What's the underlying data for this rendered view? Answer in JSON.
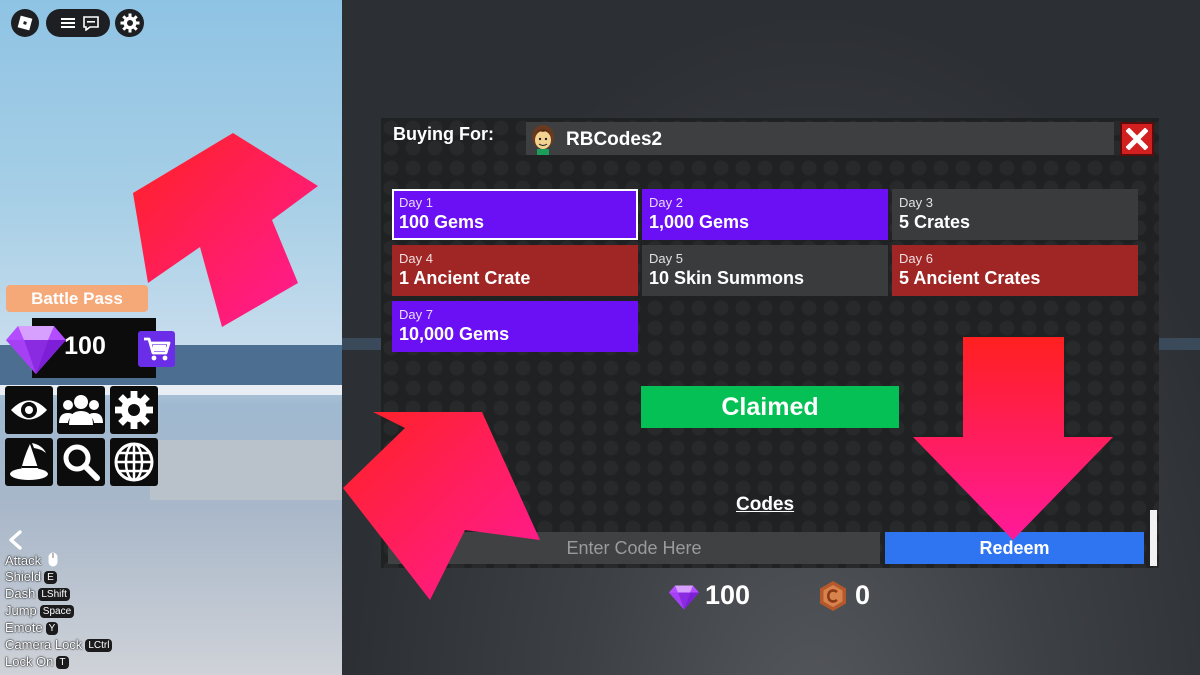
{
  "hud": {
    "battle_pass_label": "Battle Pass",
    "gem_count": "100"
  },
  "controls": [
    {
      "action": "Attack",
      "key": ""
    },
    {
      "action": "Shield",
      "key": "E"
    },
    {
      "action": "Dash",
      "key": "LShift"
    },
    {
      "action": "Jump",
      "key": "Space"
    },
    {
      "action": "Emote",
      "key": "Y"
    },
    {
      "action": "Camera Lock",
      "key": "LCtrl"
    },
    {
      "action": "Lock On",
      "key": "T"
    }
  ],
  "dialog": {
    "buying_for_label": "Buying For:",
    "username": "RBCodes2",
    "days": [
      {
        "label": "Day 1",
        "reward": "100 Gems",
        "style": "purple",
        "selected": true
      },
      {
        "label": "Day 2",
        "reward": "1,000 Gems",
        "style": "purple",
        "selected": false
      },
      {
        "label": "Day 3",
        "reward": "5 Crates",
        "style": "gray",
        "selected": false
      },
      {
        "label": "Day 4",
        "reward": "1 Ancient Crate",
        "style": "red",
        "selected": false
      },
      {
        "label": "Day 5",
        "reward": "10 Skin Summons",
        "style": "gray",
        "selected": false
      },
      {
        "label": "Day 6",
        "reward": "5 Ancient Crates",
        "style": "red",
        "selected": false
      },
      {
        "label": "Day 7",
        "reward": "10,000 Gems",
        "style": "purple",
        "selected": false
      }
    ],
    "claimed_label": "Claimed",
    "codes_label": "Codes",
    "code_placeholder": "Enter Code Here",
    "redeem_label": "Redeem",
    "gems_value": "100",
    "coins_value": "0"
  },
  "colors": {
    "purple": "#6b10f5",
    "red": "#a02626",
    "gray": "#3a3b3d",
    "claimed_green": "#05c054",
    "redeem_blue": "#2f74f0",
    "close_red": "#d21f1f",
    "cart_purple": "#6b2ee8",
    "battle_pass_orange": "#f5a878"
  },
  "icons": [
    "roblox-logo-icon",
    "menu-icon",
    "chat-icon",
    "settings-icon",
    "gem-icon",
    "shopping-cart-icon",
    "eye-icon",
    "friends-icon",
    "gear-icon",
    "wizard-hat-icon",
    "search-icon",
    "globe-icon",
    "back-chevron-icon",
    "mouse-icon",
    "close-icon",
    "coin-icon",
    "avatar"
  ]
}
